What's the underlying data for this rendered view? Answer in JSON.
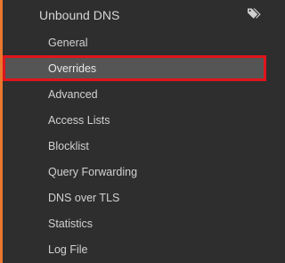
{
  "section": {
    "title": "Unbound DNS",
    "icon": "tags-icon"
  },
  "menu": {
    "items": [
      {
        "label": "General"
      },
      {
        "label": "Overrides"
      },
      {
        "label": "Advanced"
      },
      {
        "label": "Access Lists"
      },
      {
        "label": "Blocklist"
      },
      {
        "label": "Query Forwarding"
      },
      {
        "label": "DNS over TLS"
      },
      {
        "label": "Statistics"
      },
      {
        "label": "Log File"
      }
    ],
    "active_index": 1
  },
  "colors": {
    "background": "#2e2e2e",
    "accent": "#e9772e",
    "active_background": "#555555",
    "highlight_border": "#e0151b",
    "text": "#d2d2d2"
  }
}
